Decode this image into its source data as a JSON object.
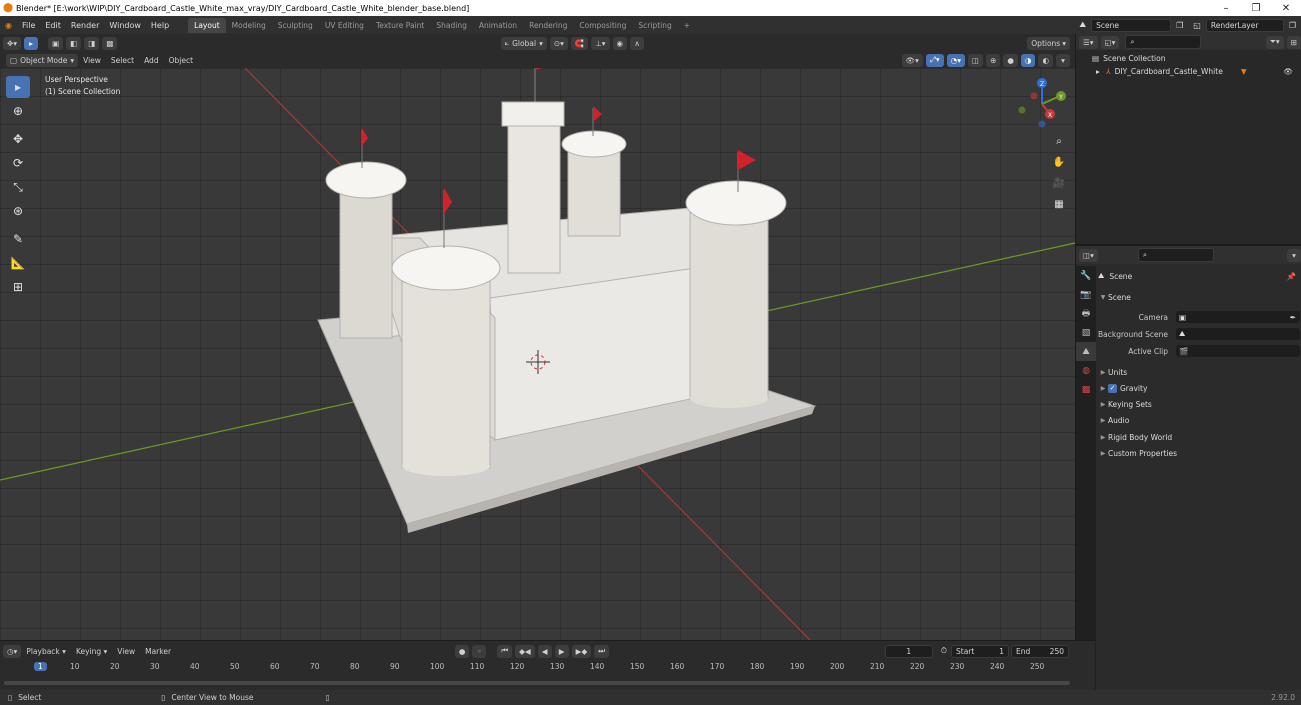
{
  "window": {
    "title": "Blender* [E:\\work\\WIP\\DIY_Cardboard_Castle_White_max_vray/DIY_Cardboard_Castle_White_blender_base.blend]",
    "minimize_icon": "–",
    "restore_icon": "❐",
    "close_icon": "✕"
  },
  "menu": {
    "items": [
      "File",
      "Edit",
      "Render",
      "Window",
      "Help"
    ],
    "workspaces": [
      "Layout",
      "Modeling",
      "Sculpting",
      "UV Editing",
      "Texture Paint",
      "Shading",
      "Animation",
      "Rendering",
      "Compositing",
      "Scripting"
    ],
    "active_workspace": "Layout",
    "add_workspace": "+",
    "scene_name": "Scene",
    "view_layer": "RenderLayer"
  },
  "viewport_header": {
    "transform_orientation": "Global",
    "options_label": "Options"
  },
  "viewport_header2": {
    "mode": "Object Mode",
    "menus": [
      "View",
      "Select",
      "Add",
      "Object"
    ]
  },
  "viewport": {
    "info_line1": "User Perspective",
    "info_line2": "(1) Scene Collection",
    "gizmo_axes": {
      "x": "X",
      "y": "Y",
      "z": "Z"
    }
  },
  "outliner": {
    "search_placeholder": "",
    "root": "Scene Collection",
    "objects": [
      "DIY_Cardboard_Castle_White"
    ]
  },
  "properties": {
    "context": "Scene",
    "section": "Scene",
    "rows": [
      {
        "label": "Camera",
        "value": ""
      },
      {
        "label": "Background Scene",
        "value": ""
      },
      {
        "label": "Active Clip",
        "value": ""
      }
    ],
    "panels": [
      "Units",
      "Gravity",
      "Keying Sets",
      "Audio",
      "Rigid Body World",
      "Custom Properties"
    ],
    "gravity_checked": true
  },
  "timeline": {
    "menus": [
      "Playback",
      "Keying",
      "View",
      "Marker"
    ],
    "current_frame": "1",
    "start_label": "Start",
    "start_value": "1",
    "end_label": "End",
    "end_value": "250",
    "ticks": [
      "1",
      "10",
      "20",
      "30",
      "40",
      "50",
      "60",
      "70",
      "80",
      "90",
      "100",
      "110",
      "120",
      "130",
      "140",
      "150",
      "160",
      "170",
      "180",
      "190",
      "200",
      "210",
      "220",
      "230",
      "240",
      "250"
    ]
  },
  "statusbar": {
    "left_action": "Select",
    "middle_action": "Center View to Mouse",
    "version": "2.92.0"
  },
  "colors": {
    "accent": "#4772b3",
    "x_axis": "#a33a3a",
    "y_axis": "#6c9a27",
    "orange": "#e87d0d"
  }
}
